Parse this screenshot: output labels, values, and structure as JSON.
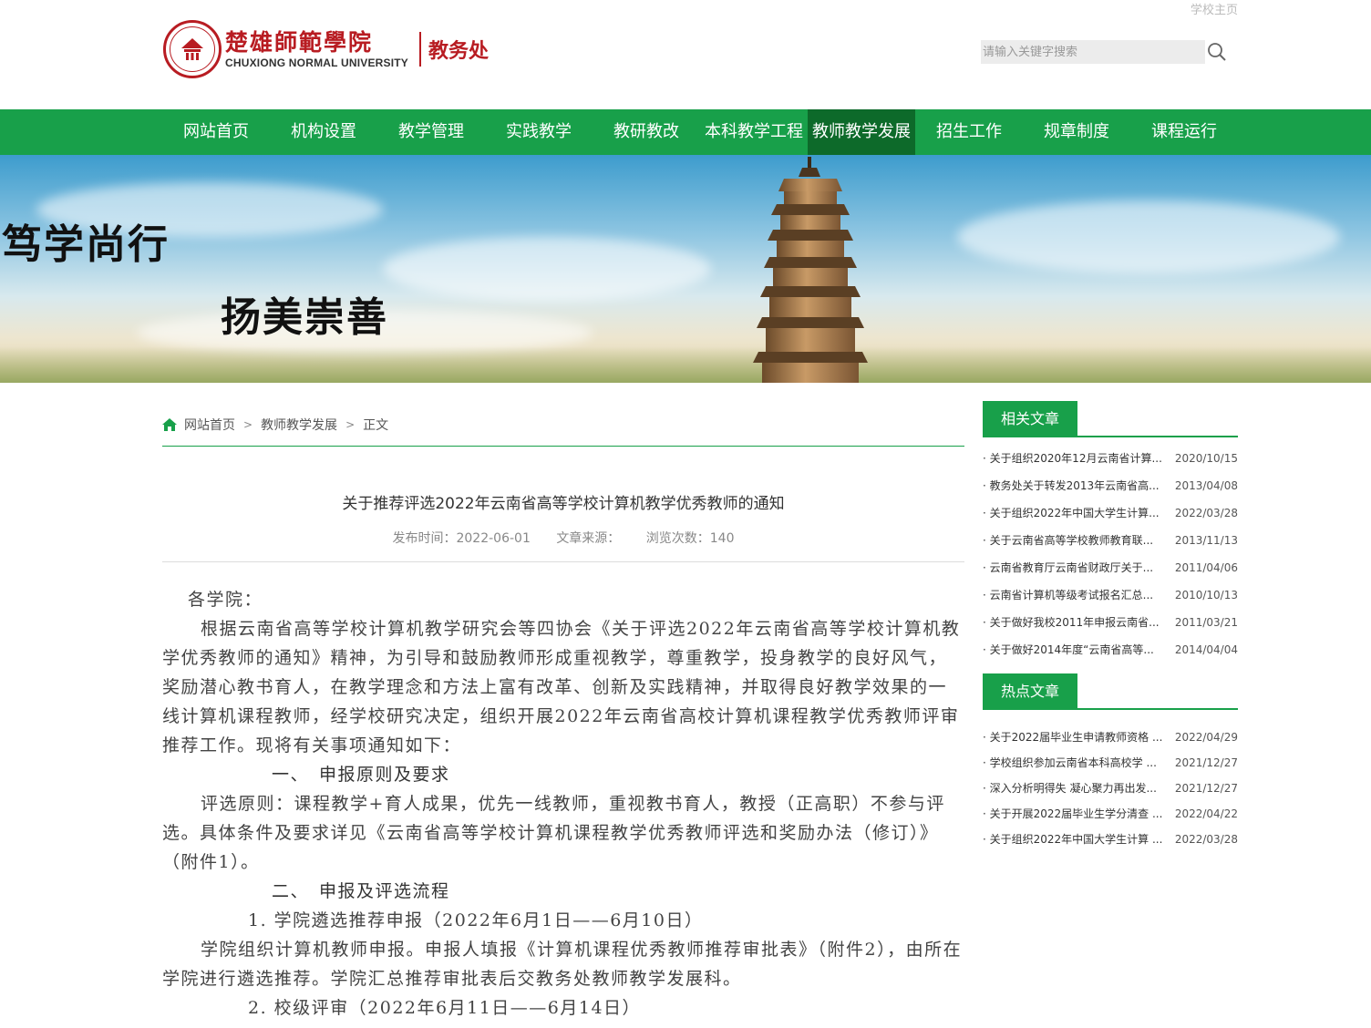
{
  "header": {
    "school_home": "学校主页",
    "logo_cn": "楚雄師範學院",
    "logo_en": "CHUXIONG NORMAL UNIVERSITY",
    "department": "教务处",
    "search_placeholder": "请输入关键字搜索"
  },
  "nav": {
    "items": [
      {
        "label": "网站首页"
      },
      {
        "label": "机构设置"
      },
      {
        "label": "教学管理"
      },
      {
        "label": "实践教学"
      },
      {
        "label": "教研教改"
      },
      {
        "label": "本科教学工程"
      },
      {
        "label": "教师教学发展"
      },
      {
        "label": "招生工作"
      },
      {
        "label": "规章制度"
      },
      {
        "label": "课程运行"
      }
    ],
    "active_index": 6
  },
  "banner": {
    "slogan1": "笃学尚行",
    "slogan2": "扬美崇善"
  },
  "breadcrumb": {
    "home": "网站首页",
    "section": "教师教学发展",
    "current": "正文"
  },
  "article": {
    "title": "关于推荐评选2022年云南省高等学校计算机教学优秀教师的通知",
    "publish_time": "发布时间：2022-06-01",
    "source": "文章来源：",
    "views": "浏览次数：140",
    "paragraphs": {
      "p1": "各学院：",
      "p2": "根据云南省高等学校计算机教学研究会等四协会《关于评选2022年云南省高等学校计算机教学优秀教师的通知》精神，为引导和鼓励教师形成重视教学，尊重教学，投身教学的良好风气，奖励潜心教书育人，在教学理念和方法上富有改革、创新及实践精神，并取得良好教学效果的一线计算机课程教师，经学校研究决定，组织开展2022年云南省高校计算机课程教学优秀教师评审推荐工作。现将有关事项通知如下：",
      "h1": "一、　申报原则及要求",
      "p3": "评选原则：课程教学+育人成果，优先一线教师，重视教书育人，教授（正高职）不参与评选。具体条件及要求详见《云南省高等学校计算机课程教学优秀教师评选和奖励办法（修订）》（附件1）。",
      "h2": "二、　申报及评选流程",
      "s1": "1.  学院遴选推荐申报（2022年6月1日——6月10日）",
      "p4": "学院组织计算机教师申报。申报人填报《计算机课程优秀教师推荐审批表》（附件2），由所在学院进行遴选推荐。学院汇总推荐审批表后交教务处教师教学发展科。",
      "s2": "2.  校级评审（2022年6月11日——6月14日）"
    }
  },
  "related": {
    "heading": "相关文章",
    "items": [
      {
        "title": "关于组织2020年12月云南省计算...",
        "date": "2020/10/15"
      },
      {
        "title": "教务处关于转发2013年云南省高...",
        "date": "2013/04/08"
      },
      {
        "title": "关于组织2022年中国大学生计算...",
        "date": "2022/03/28"
      },
      {
        "title": "关于云南省高等学校教师教育联...",
        "date": "2013/11/13"
      },
      {
        "title": "云南省教育厅云南省财政厅关于...",
        "date": "2011/04/06"
      },
      {
        "title": "云南省计算机等级考试报名汇总...",
        "date": "2010/10/13"
      },
      {
        "title": "关于做好我校2011年申报云南省...",
        "date": "2011/03/21"
      },
      {
        "title": "关于做好2014年度“云南省高等...",
        "date": "2014/04/04"
      }
    ]
  },
  "hot": {
    "heading": "热点文章",
    "items": [
      {
        "title": "关于2022届毕业生申请教师资格 ...",
        "date": "2022/04/29"
      },
      {
        "title": "学校组织参加云南省本科高校学 ...",
        "date": "2021/12/27"
      },
      {
        "title": "深入分析明得失 凝心聚力再出发...",
        "date": "2021/12/27"
      },
      {
        "title": "关于开展2022届毕业生学分清查 ...",
        "date": "2022/04/22"
      },
      {
        "title": "关于组织2022年中国大学生计算 ...",
        "date": "2022/03/28"
      }
    ]
  },
  "colors": {
    "brand_green": "#18a04a",
    "active_nav": "#0d6a2a",
    "logo_red": "#b81c22"
  }
}
